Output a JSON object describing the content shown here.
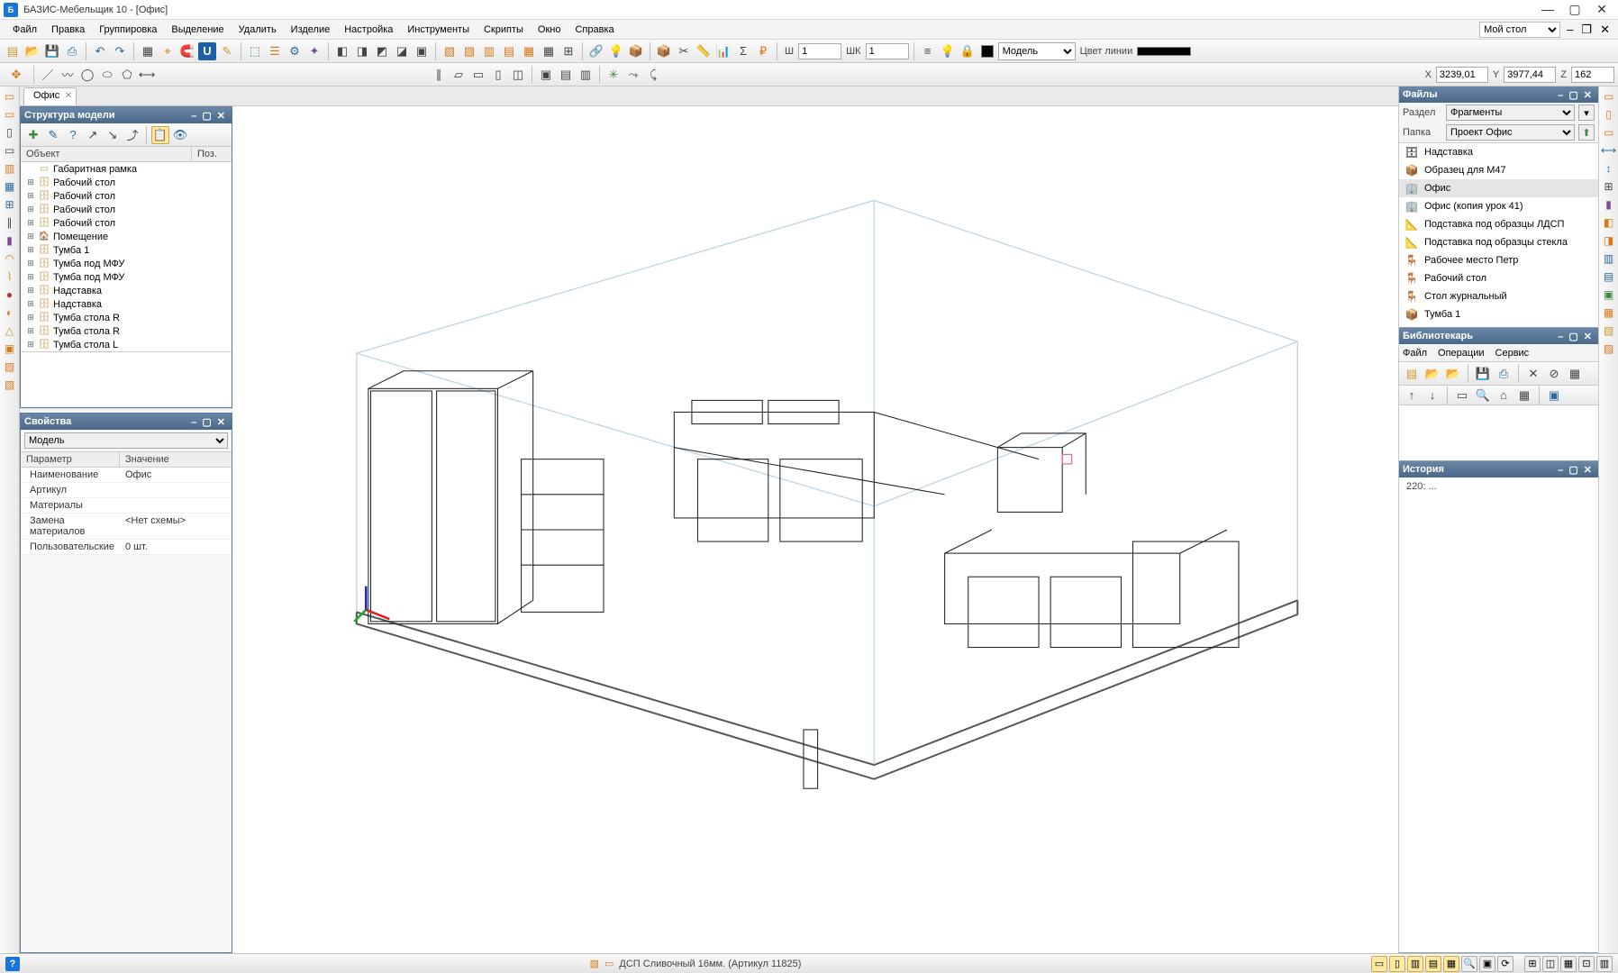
{
  "title": "БАЗИС-Мебельщик 10 - [Офис]",
  "menu": [
    "Файл",
    "Правка",
    "Группировка",
    "Выделение",
    "Удалить",
    "Изделие",
    "Настройка",
    "Инструменты",
    "Скрипты",
    "Окно",
    "Справка"
  ],
  "workspace_label": "Мой стол",
  "coords": {
    "x_label": "X",
    "x": "3239,01",
    "y_label": "Y",
    "y": "3977,44",
    "z_label": "Z",
    "z": "162"
  },
  "tb1": {
    "sh_label": "Ш",
    "sh_val": "1",
    "shk_label": "ШК",
    "shk_val": "1",
    "model_sel": "Модель",
    "line_color_label": "Цвет линии"
  },
  "doc_tab": {
    "name": "Офис"
  },
  "struct": {
    "title": "Структура модели",
    "cols": {
      "obj": "Объект",
      "pos": "Поз."
    },
    "items": [
      {
        "exp": "",
        "ic": "▭",
        "name": "Габаритная рамка"
      },
      {
        "exp": "⊞",
        "ic": "🗄",
        "name": "Рабочий стол"
      },
      {
        "exp": "⊞",
        "ic": "🗄",
        "name": "Рабочий стол"
      },
      {
        "exp": "⊞",
        "ic": "🗄",
        "name": "Рабочий стол"
      },
      {
        "exp": "⊞",
        "ic": "🗄",
        "name": "Рабочий стол"
      },
      {
        "exp": "⊞",
        "ic": "🏠",
        "name": "Помещение"
      },
      {
        "exp": "⊞",
        "ic": "🗄",
        "name": "Тумба 1"
      },
      {
        "exp": "⊞",
        "ic": "🗄",
        "name": "Тумба под МФУ"
      },
      {
        "exp": "⊞",
        "ic": "🗄",
        "name": "Тумба под МФУ"
      },
      {
        "exp": "⊞",
        "ic": "🗄",
        "name": "Надставка"
      },
      {
        "exp": "⊞",
        "ic": "🗄",
        "name": "Надставка"
      },
      {
        "exp": "⊞",
        "ic": "🗄",
        "name": "Тумба стола R"
      },
      {
        "exp": "⊞",
        "ic": "🗄",
        "name": "Тумба стола R"
      },
      {
        "exp": "⊞",
        "ic": "🗄",
        "name": "Тумба стола L"
      }
    ]
  },
  "props": {
    "title": "Свойства",
    "selector": "Модель",
    "cols": {
      "param": "Параметр",
      "value": "Значение"
    },
    "rows": [
      {
        "p": "Наименование",
        "v": "Офис"
      },
      {
        "p": "Артикул",
        "v": ""
      },
      {
        "p": "Материалы",
        "v": ""
      },
      {
        "p": "Замена материалов",
        "v": "<Нет схемы>"
      },
      {
        "p": "Пользовательские",
        "v": "0 шт."
      }
    ]
  },
  "files": {
    "title": "Файлы",
    "section_label": "Раздел",
    "section": "Фрагменты",
    "folder_label": "Папка",
    "folder": "Проект Офис",
    "items": [
      {
        "ic": "🗄",
        "name": "Надставка",
        "sel": false
      },
      {
        "ic": "📦",
        "name": "Образец для М47",
        "sel": false
      },
      {
        "ic": "🏢",
        "name": "Офис",
        "sel": true
      },
      {
        "ic": "🏢",
        "name": "Офис (копия урок 41)",
        "sel": false
      },
      {
        "ic": "📐",
        "name": "Подставка под образцы ЛДСП",
        "sel": false
      },
      {
        "ic": "📐",
        "name": "Подставка под образцы стекла",
        "sel": false
      },
      {
        "ic": "🪑",
        "name": "Рабочее место Петр",
        "sel": false
      },
      {
        "ic": "🪑",
        "name": "Рабочий стол",
        "sel": false
      },
      {
        "ic": "🪑",
        "name": "Стол журнальный",
        "sel": false
      },
      {
        "ic": "📦",
        "name": "Тумба 1",
        "sel": false
      }
    ]
  },
  "librarian": {
    "title": "Библиотекарь",
    "menu": [
      "Файл",
      "Операции",
      "Сервис"
    ]
  },
  "history": {
    "title": "История",
    "entry": "220:   ..."
  },
  "status": {
    "material": "ДСП Сливочный 16мм. (Артикул 11825)"
  }
}
